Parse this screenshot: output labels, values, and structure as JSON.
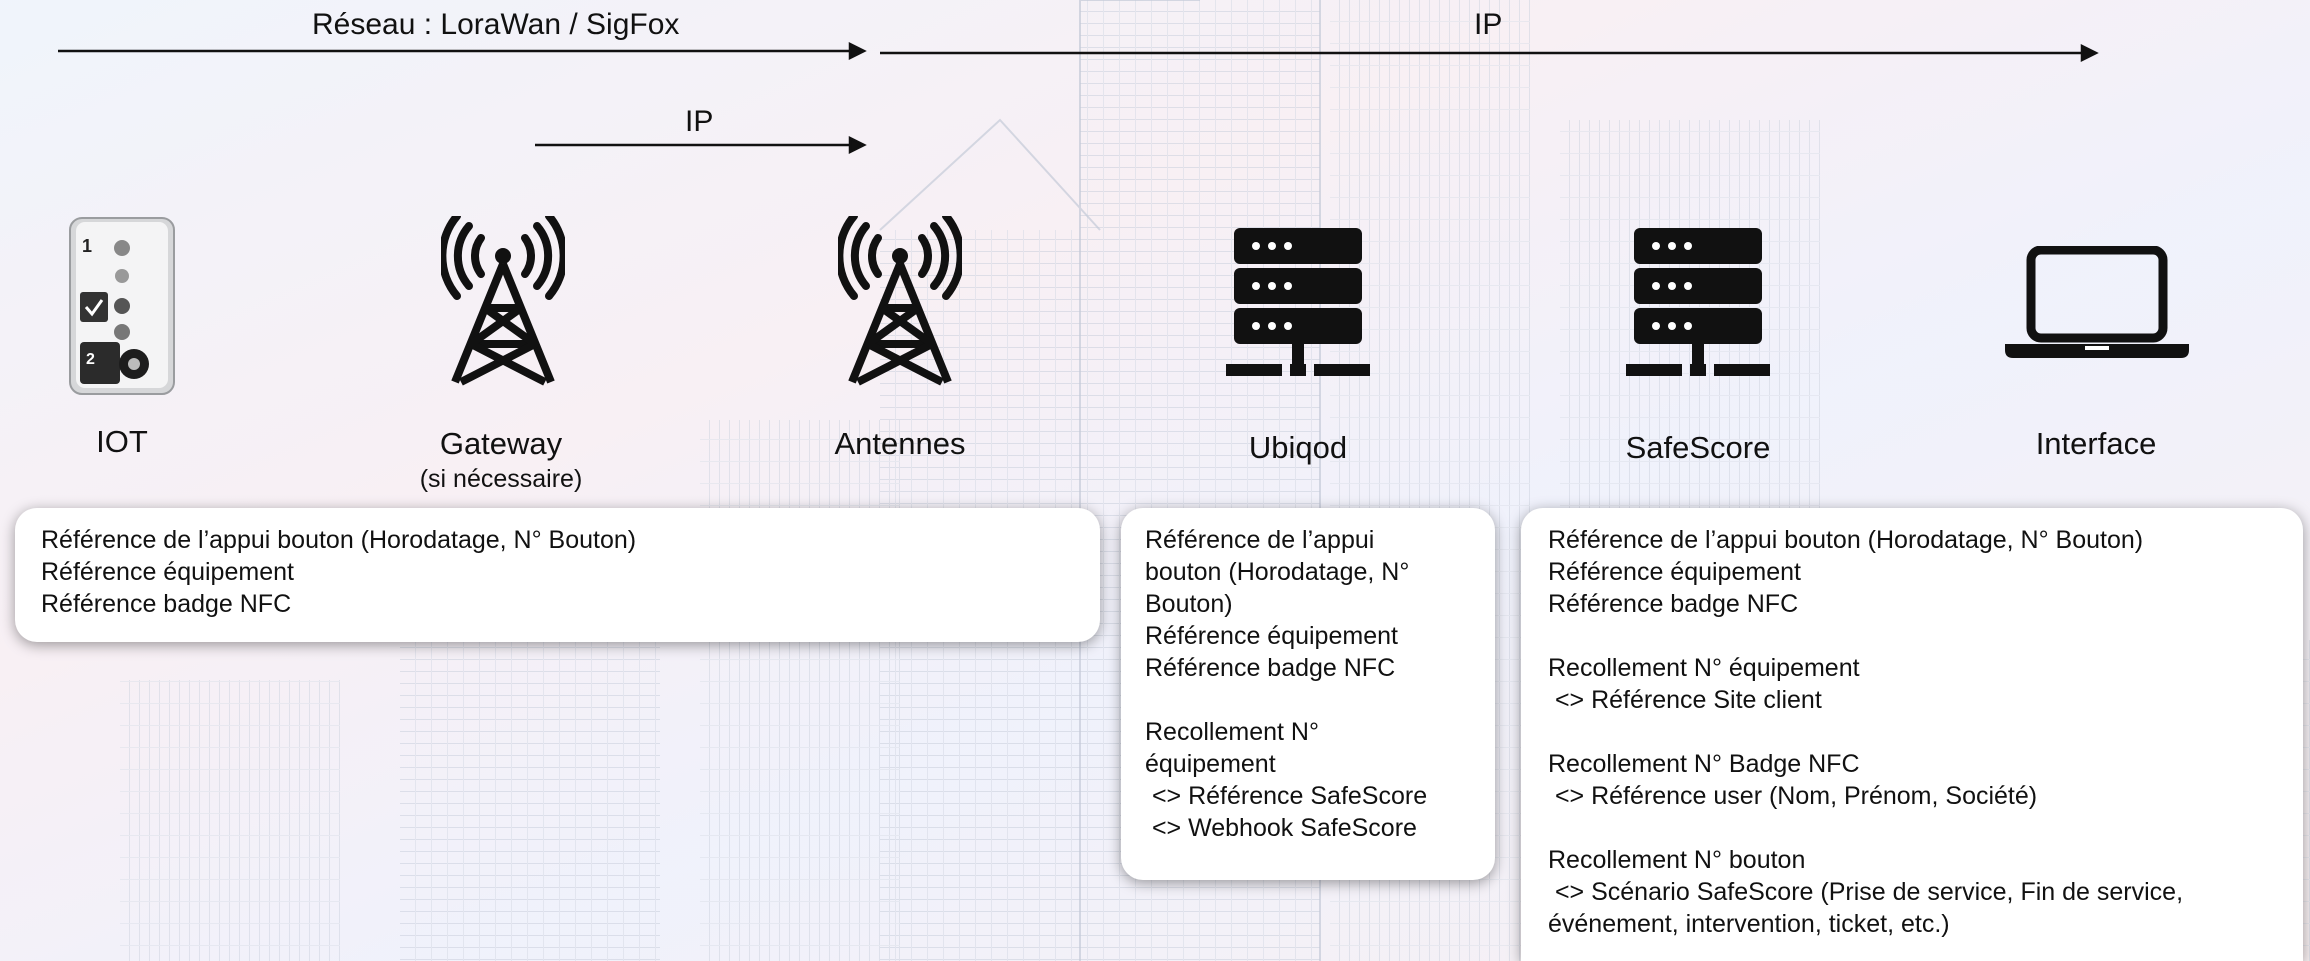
{
  "arrows": {
    "network_label": "Réseau : LoraWan / SigFox",
    "ip_top_label": "IP",
    "ip_gateway_label": "IP"
  },
  "nodes": [
    {
      "label": "IOT",
      "icon": "iot-device-icon"
    },
    {
      "label": "Gateway",
      "sublabel": "(si nécessaire)",
      "icon": "antenna-tower-icon"
    },
    {
      "label": "Antennes",
      "icon": "antenna-tower-icon"
    },
    {
      "label": "Ubiqod",
      "icon": "server-icon"
    },
    {
      "label": "SafeScore",
      "icon": "server-icon"
    },
    {
      "label": "Interface",
      "icon": "laptop-icon"
    }
  ],
  "iot_device": {
    "step1": "1",
    "step2": "2"
  },
  "cards": {
    "device": {
      "lines": [
        "Référence de l’appui bouton (Horodatage, N° Bouton)",
        "Référence équipement",
        "Référence badge NFC"
      ]
    },
    "ubiqod": {
      "lines": [
        "Référence de l’appui",
        "bouton (Horodatage, N°",
        "Bouton)",
        "Référence équipement",
        "Référence badge NFC",
        "",
        "Recollement N°",
        "équipement",
        " <> Référence SafeScore",
        " <> Webhook SafeScore"
      ]
    },
    "safescore": {
      "lines": [
        "Référence de l’appui bouton (Horodatage, N° Bouton)",
        "Référence équipement",
        "Référence badge NFC",
        "",
        "Recollement N° équipement",
        " <> Référence Site client",
        "",
        "Recollement N° Badge NFC",
        " <> Référence user (Nom, Prénom, Société)",
        "",
        "Recollement N° bouton",
        " <> Scénario SafeScore (Prise de service, Fin de service,",
        "événement, intervention, ticket, etc.)"
      ]
    }
  },
  "colors": {
    "line": "#111111",
    "card_bg": "#ffffff",
    "background_tint": "#e9ecf3"
  }
}
